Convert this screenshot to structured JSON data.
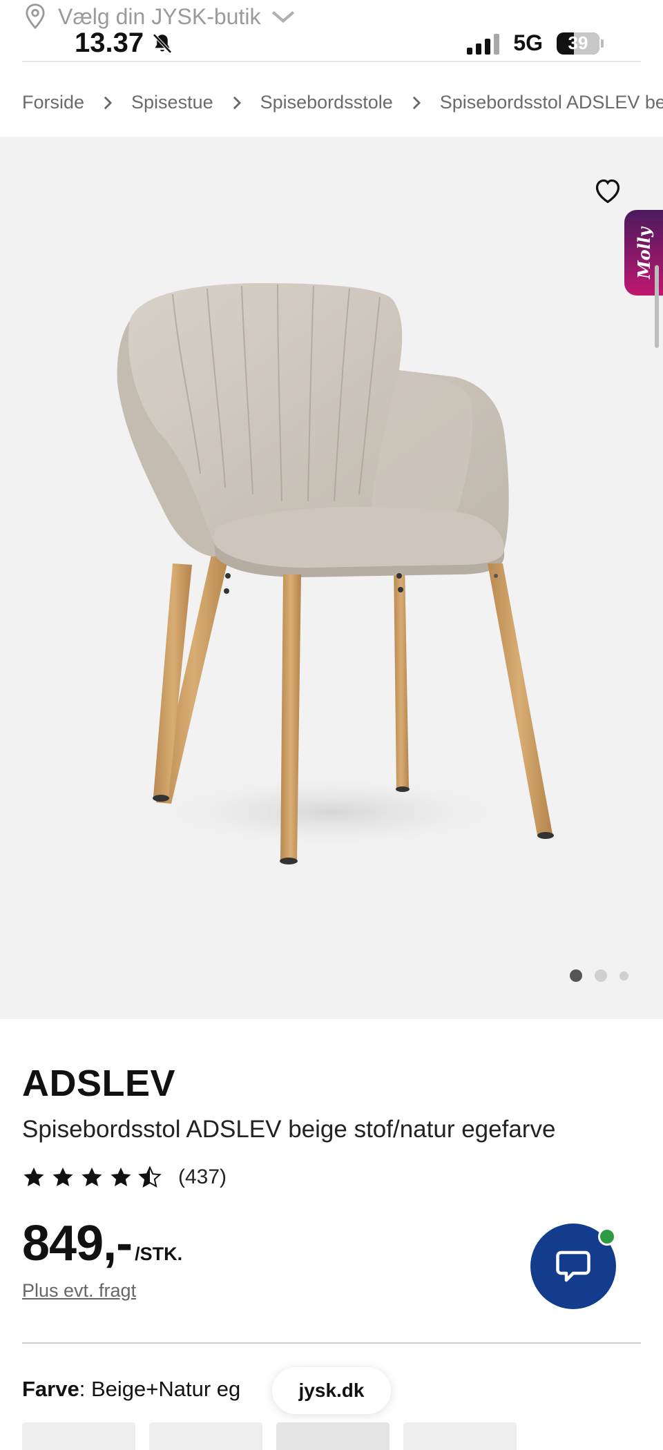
{
  "status_bar": {
    "store_selector": "Vælg din JYSK-butik",
    "time": "13.37",
    "network": "5G",
    "battery": "39"
  },
  "breadcrumb": [
    "Forside",
    "Spisestue",
    "Spisebordsstole",
    "Spisebordsstol ADSLEV be"
  ],
  "gallery": {
    "slides_count": 3,
    "active_slide": 1,
    "assistant_badge": "Molly"
  },
  "product": {
    "brand": "ADSLEV",
    "name": "Spisebordsstol ADSLEV beige stof/natur egefarve",
    "rating_stars": 4.5,
    "review_count": "(437)",
    "price": "849,-",
    "price_unit": "/STK.",
    "freight_link": "Plus evt. fragt",
    "color_label": "Farve",
    "color_value": ": Beige+Natur eg"
  },
  "browser": {
    "url": "jysk.dk"
  },
  "colors": {
    "chat_button": "#143c8c",
    "online_dot": "#2e9b44",
    "molly_gradient_end": "#c0176f"
  }
}
